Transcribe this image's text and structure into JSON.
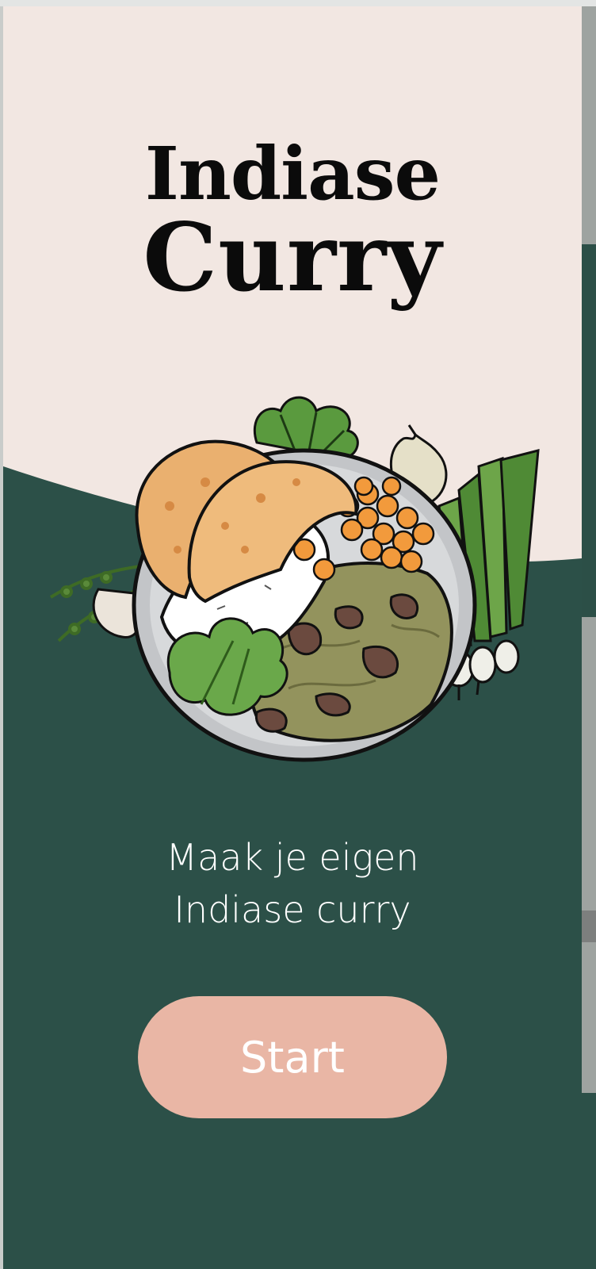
{
  "title": {
    "line1": "Indiase",
    "line2": "Curry"
  },
  "tagline": {
    "line1": "Maak je eigen",
    "line2": "Indiase curry"
  },
  "start_button": {
    "label": "Start"
  },
  "illustration": {
    "icon": "indian-curry-plate-illustration"
  },
  "colors": {
    "background_top": "#f2e7e2",
    "background_bottom": "#2c5048",
    "button": "#e9b6a5",
    "title_text": "#0b0b0b",
    "body_text": "#ffffff"
  }
}
